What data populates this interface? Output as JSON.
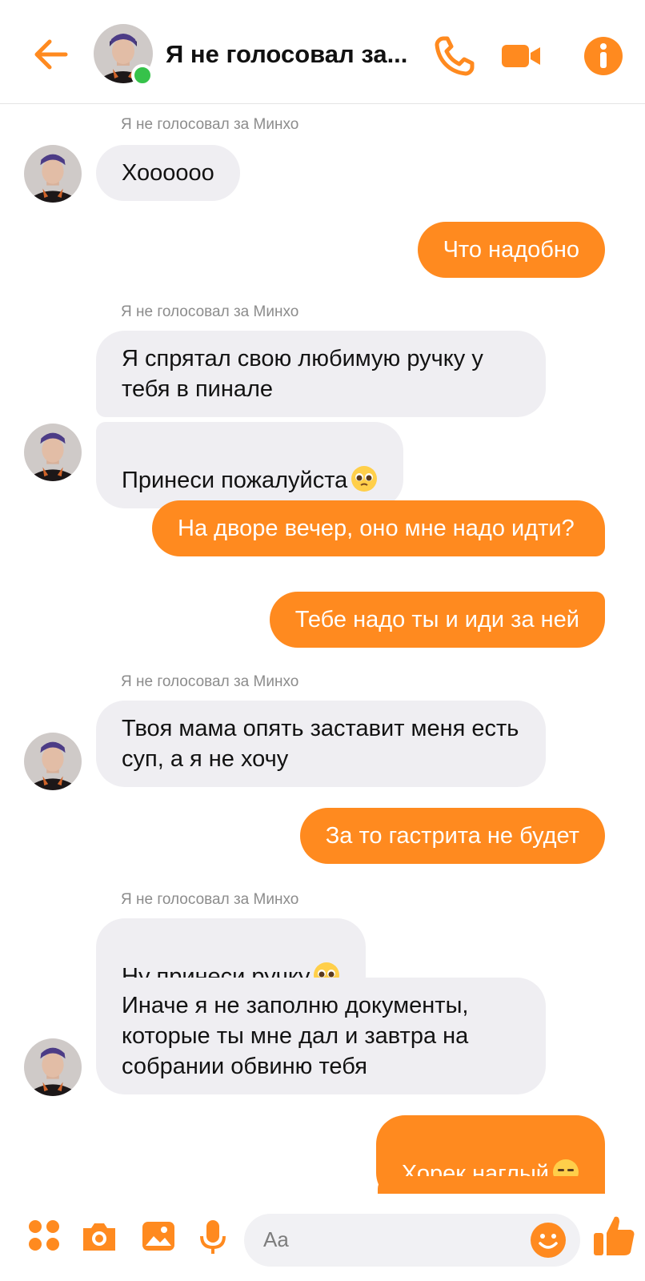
{
  "header": {
    "title": "Я не голосовал за...",
    "accent_color": "#ff8a1f",
    "online_color": "#36c24a"
  },
  "messages": [
    {
      "type": "label",
      "text": "Я не голосовал за Минхо"
    },
    {
      "type": "in",
      "text": "Хоооооо"
    },
    {
      "type": "out",
      "text": "Что надобно"
    },
    {
      "type": "label",
      "text": "Я не голосовал за Минхо"
    },
    {
      "type": "in",
      "text": "Я спрятал свою любимую ручку у тебя в пинале"
    },
    {
      "type": "in",
      "text": "Принеси пожалуйста",
      "emoji": "pleading-face"
    },
    {
      "type": "out",
      "text": "На дворе вечер, оно мне надо идти?"
    },
    {
      "type": "out",
      "text": "Тебе надо ты и иди за ней"
    },
    {
      "type": "label",
      "text": "Я не голосовал за Минхо"
    },
    {
      "type": "in",
      "text": "Твоя мама опять заставит меня есть суп, а я не хочу"
    },
    {
      "type": "out",
      "text": "За то гастрита не будет"
    },
    {
      "type": "label",
      "text": "Я не голосовал за Минхо"
    },
    {
      "type": "in",
      "text": "Ну принеси ручку",
      "emoji": "pleading-face"
    },
    {
      "type": "in",
      "text": "Иначе я не заполню документы, которые ты мне дал и завтра на собрании обвиню тебя"
    },
    {
      "type": "out",
      "text": "Хорек наглый",
      "emoji": "expressionless-face"
    }
  ],
  "composer": {
    "placeholder": "Aa"
  }
}
